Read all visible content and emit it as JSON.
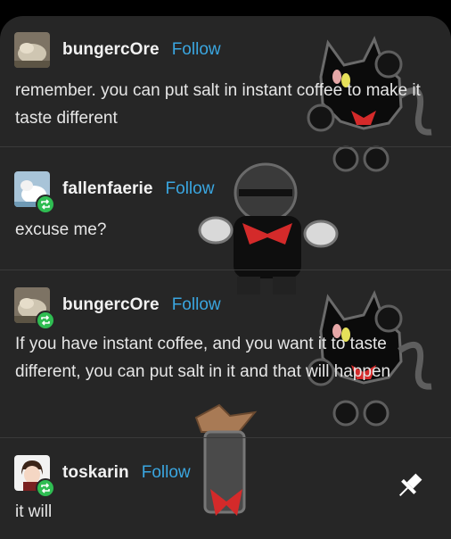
{
  "posts": [
    {
      "username": "bungercOre",
      "follow_label": "Follow",
      "text": "remember. you can put salt in instant coffee to make it taste different",
      "avatar_icon": "cat-avatar",
      "reblog": false
    },
    {
      "username": "fallenfaerie",
      "follow_label": "Follow",
      "text": "excuse me?",
      "avatar_icon": "cat-avatar",
      "reblog": true
    },
    {
      "username": "bungercOre",
      "follow_label": "Follow",
      "text": "If you have instant coffee, and you want it to taste different, you can put salt in it and that will happen",
      "avatar_icon": "cat-avatar",
      "reblog": true
    },
    {
      "username": "toskarin",
      "follow_label": "Follow",
      "text": "it will",
      "avatar_icon": "anime-avatar",
      "reblog": true
    }
  ],
  "colors": {
    "card_bg": "#262626",
    "follow": "#3aa6e0",
    "reblog_badge": "#2fbd52",
    "text": "#e6e6e6"
  },
  "icons": {
    "reblog": "reblog-icon",
    "pin": "pin-icon"
  }
}
